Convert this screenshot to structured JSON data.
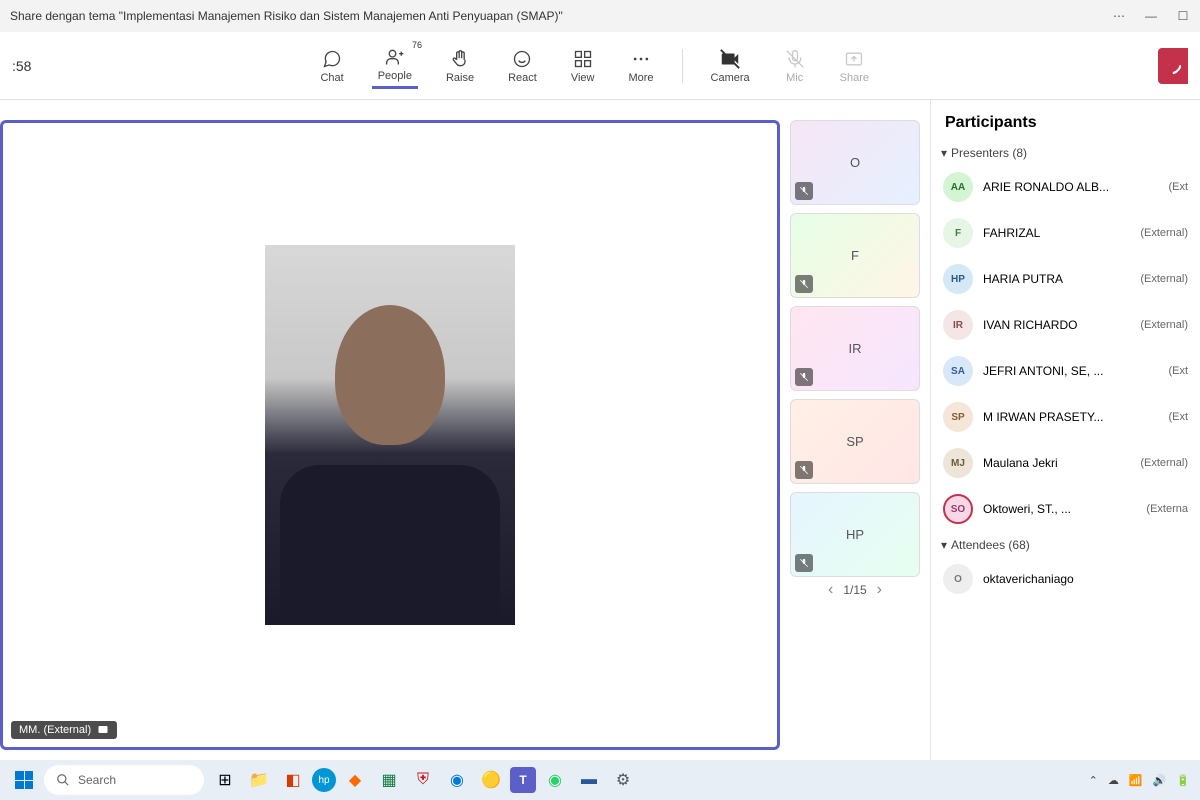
{
  "titlebar": {
    "title": "Share dengan tema \"Implementasi Manajemen Risiko dan Sistem Manajemen Anti Penyuapan (SMAP)\""
  },
  "toolbar": {
    "time": ":58",
    "chat": "Chat",
    "people": "People",
    "people_count": "76",
    "raise": "Raise",
    "react": "React",
    "view": "View",
    "more": "More",
    "camera": "Camera",
    "mic": "Mic",
    "share": "Share"
  },
  "speaker": {
    "label": "MM. (External)"
  },
  "thumbs": [
    {
      "initials": "O",
      "cls": "av-o"
    },
    {
      "initials": "F",
      "cls": "av-f"
    },
    {
      "initials": "IR",
      "cls": "av-ir"
    },
    {
      "initials": "SP",
      "cls": "av-sp"
    },
    {
      "initials": "HP",
      "cls": "av-hp"
    }
  ],
  "pager": {
    "current": "1/15"
  },
  "panel": {
    "title": "Participants",
    "presenters_label": "Presenters (8)",
    "attendees_label": "Attendees (68)",
    "presenters": [
      {
        "initials": "AA",
        "name": "ARIE RONALDO ALB...",
        "tag": "(Ext",
        "cls": "c-aa"
      },
      {
        "initials": "F",
        "name": "FAHRIZAL",
        "tag": "(External)",
        "cls": "c-f"
      },
      {
        "initials": "HP",
        "name": "HARIA PUTRA",
        "tag": "(External)",
        "cls": "c-hp"
      },
      {
        "initials": "IR",
        "name": "IVAN RICHARDO",
        "tag": "(External)",
        "cls": "c-ir"
      },
      {
        "initials": "SA",
        "name": "JEFRI ANTONI, SE, ...",
        "tag": "(Ext",
        "cls": "c-sa"
      },
      {
        "initials": "SP",
        "name": "M IRWAN PRASETY...",
        "tag": "(Ext",
        "cls": "c-sp"
      },
      {
        "initials": "MJ",
        "name": "Maulana Jekri",
        "tag": "(External)",
        "cls": "c-mj"
      },
      {
        "initials": "SO",
        "name": "Oktoweri, ST., ...",
        "tag": "(Externa",
        "cls": "c-so"
      }
    ],
    "attendees": [
      {
        "initials": "O",
        "name": "oktaverichaniago",
        "tag": "",
        "cls": "c-o"
      }
    ]
  },
  "taskbar": {
    "search_placeholder": "Search"
  }
}
